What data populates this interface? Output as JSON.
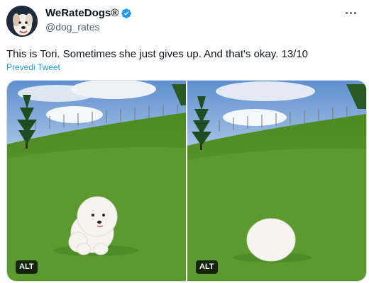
{
  "author": {
    "display_name": "WeRateDogs®",
    "handle": "@dog_rates",
    "avatar_icon": "dog-avatar-icon",
    "verified_icon": "verified-badge-icon",
    "verified_color": "#1d9bf0"
  },
  "tweet": {
    "text": "This is Tori. Sometimes she just gives up. And that's okay. 13/10",
    "translate_label": "Prevedi Tweet"
  },
  "media": {
    "photos": [
      {
        "alt_label": "ALT"
      },
      {
        "alt_label": "ALT"
      }
    ]
  },
  "colors": {
    "text": "#0f1419",
    "secondary": "#536471",
    "link": "#1d9bf0",
    "sky": "#7fa9d9",
    "grass": "#5a9a2e"
  }
}
